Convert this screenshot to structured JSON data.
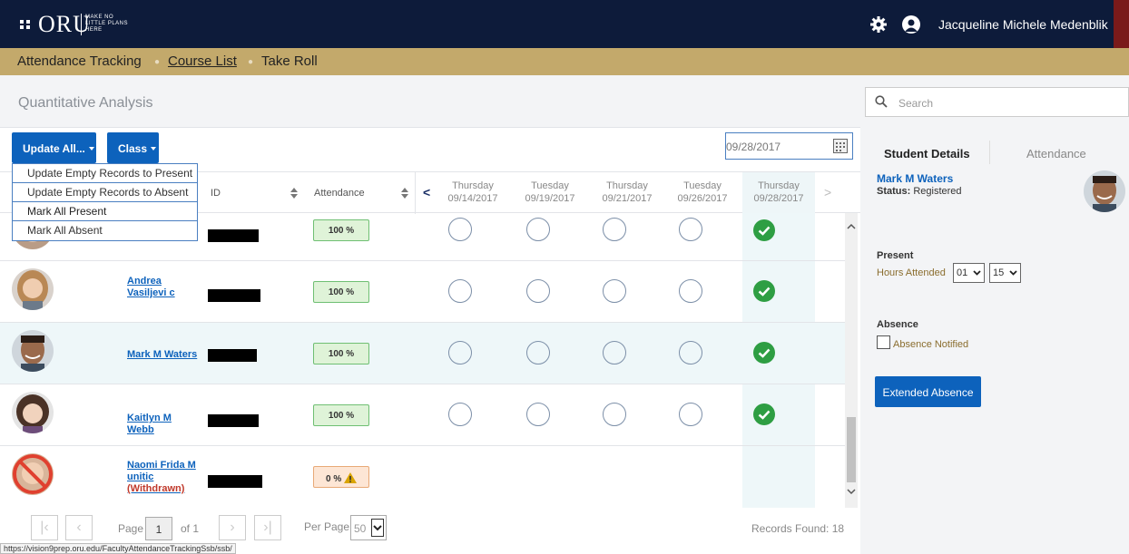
{
  "header": {
    "logo": "ORU",
    "logo_tagline": [
      "MAKE NO",
      "LITTLE PLANS",
      "HERE"
    ],
    "user_name": "Jacqueline Michele Medenblik"
  },
  "breadcrumb": {
    "items": [
      "Attendance Tracking",
      "Course List",
      "Take Roll"
    ]
  },
  "page": {
    "title": "Quantitative Analysis"
  },
  "toolbar": {
    "update_all_label": "Update All...",
    "class_label": "Class",
    "date_value": "09/28/2017"
  },
  "update_menu": {
    "items": [
      "Update Empty Records to Present",
      "Update Empty Records to Absent",
      "Mark All Present",
      "Mark All Absent"
    ]
  },
  "table": {
    "col_id": "ID",
    "col_attendance": "Attendance",
    "dates": [
      {
        "day": "Thursday",
        "date": "09/14/2017"
      },
      {
        "day": "Tuesday",
        "date": "09/19/2017"
      },
      {
        "day": "Thursday",
        "date": "09/21/2017"
      },
      {
        "day": "Tuesday",
        "date": "09/26/2017"
      },
      {
        "day": "Thursday",
        "date": "09/28/2017"
      }
    ],
    "rows": [
      {
        "name": "",
        "attendance": "100 %"
      },
      {
        "name": "Andrea Vasiljevi c",
        "attendance": "100 %"
      },
      {
        "name": "Mark M Waters",
        "attendance": "100 %"
      },
      {
        "name": "Kaitlyn M Webb",
        "attendance": "100 %"
      },
      {
        "name": "Naomi Frida M unitic",
        "withdrawn": "(Withdrawn)",
        "attendance": "0 %"
      }
    ]
  },
  "footer": {
    "page_label": "Page",
    "page_value": "1",
    "of_label": "of 1",
    "per_page_label": "Per Page",
    "per_page_value": "50",
    "records_found": "Records Found: 18"
  },
  "status_url": "https://vision9prep.oru.edu/FacultyAttendanceTrackingSsb/ssb/",
  "search": {
    "placeholder": "Search"
  },
  "details": {
    "tab_student": "Student Details",
    "tab_attendance": "Attendance",
    "name": "Mark M Waters",
    "status_label": "Status:",
    "status_value": "Registered",
    "present_label": "Present",
    "hours_label": "Hours Attended",
    "hours_value": "01",
    "minutes_value": "15",
    "absence_label": "Absence",
    "absence_notified_label": "Absence Notified",
    "extended_absence_label": "Extended Absence"
  },
  "colors": {
    "nav_bg": "#0d1b3a",
    "gold": "#c3a96b",
    "primary": "#0d62bc",
    "check_green": "#2e9e43"
  }
}
